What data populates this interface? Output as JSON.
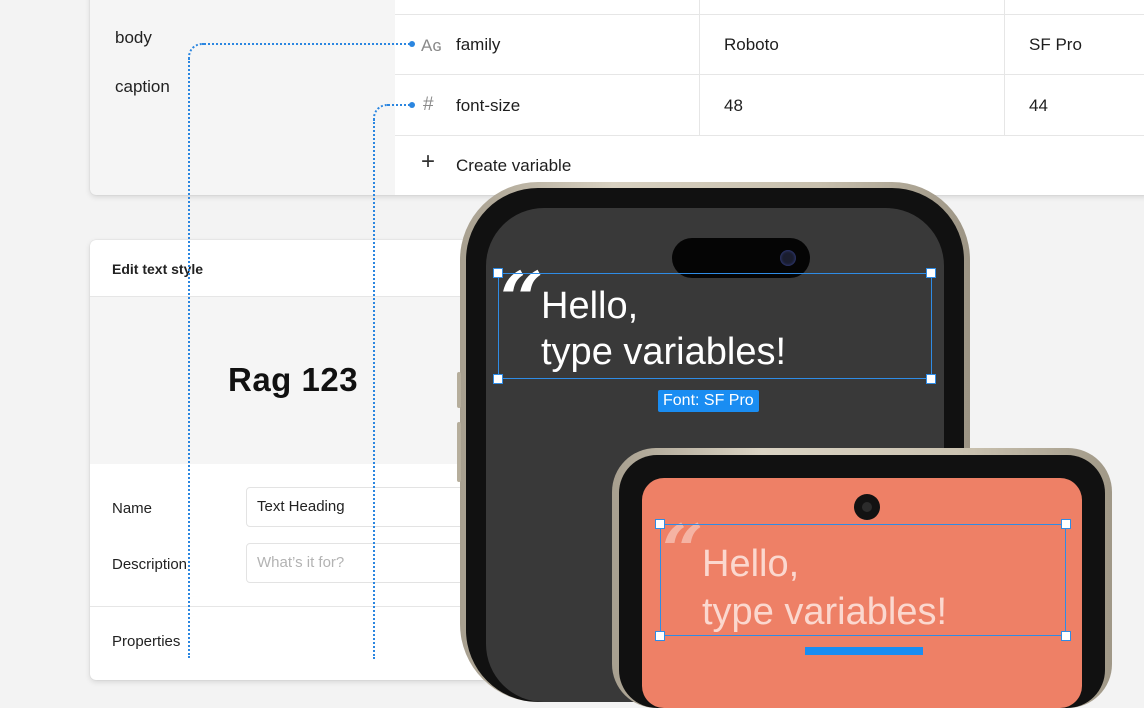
{
  "styles_list": {
    "items": [
      "body",
      "caption"
    ]
  },
  "variables_table": {
    "rows": [
      {
        "icon": "text-variable-icon",
        "icon_glyph": "Aɢ",
        "name": "family",
        "values": [
          "Roboto",
          "SF Pro"
        ]
      },
      {
        "icon": "number-variable-icon",
        "icon_glyph": "#",
        "name": "font-size",
        "values": [
          "48",
          "44"
        ]
      }
    ],
    "create_label": "Create variable",
    "create_icon_glyph": "+"
  },
  "edit_text_style": {
    "title": "Edit text style",
    "preview_text": "Rag 123",
    "name_label": "Name",
    "name_value": "Text Heading",
    "description_label": "Description",
    "description_placeholder": "What’s it for?",
    "properties_label": "Properties"
  },
  "phone_dark": {
    "quote": "“",
    "line1": "Hello,",
    "line2": "type variables!",
    "badge": "Font: SF Pro"
  },
  "phone_coral": {
    "quote": "“",
    "line1": "Hello,",
    "line2": "type variables!"
  },
  "colors": {
    "accent": "#1a8df2",
    "dark_screen": "#393939",
    "coral_screen": "#ee8066"
  }
}
